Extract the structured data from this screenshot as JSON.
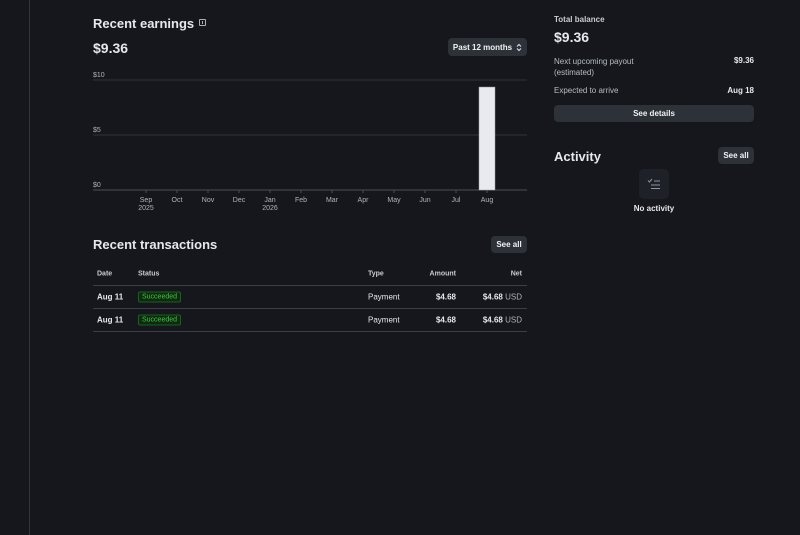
{
  "earnings": {
    "title": "Recent earnings",
    "total": "$9.36",
    "range_label": "Past 12 months"
  },
  "chart_data": {
    "type": "bar",
    "categories": [
      "Sep",
      "Oct",
      "Nov",
      "Dec",
      "Jan",
      "Feb",
      "Mar",
      "Apr",
      "May",
      "Jun",
      "Jul",
      "Aug"
    ],
    "category_sublabels": [
      "2025",
      "",
      "",
      "",
      "2026",
      "",
      "",
      "",
      "",
      "",
      "",
      ""
    ],
    "values": [
      0,
      0,
      0,
      0,
      0,
      0,
      0,
      0,
      0,
      0,
      0,
      9.36
    ],
    "yticks": [
      "$10",
      "$5",
      "$0"
    ],
    "ylim": [
      0,
      10
    ],
    "title": "",
    "xlabel": "",
    "ylabel": "",
    "grid": true,
    "bar_color": "#e8eaf0"
  },
  "transactions": {
    "title": "Recent transactions",
    "see_all_label": "See all",
    "columns": [
      "Date",
      "Status",
      "Type",
      "Amount",
      "Net"
    ],
    "rows": [
      {
        "date": "Aug 11",
        "status": "Succeeded",
        "type": "Payment",
        "amount": "$4.68",
        "net": "$4.68",
        "currency": "USD"
      },
      {
        "date": "Aug 11",
        "status": "Succeeded",
        "type": "Payment",
        "amount": "$4.68",
        "net": "$4.68",
        "currency": "USD"
      }
    ]
  },
  "balance": {
    "title": "Total balance",
    "amount": "$9.36",
    "payout_label": "Next upcoming payout (estimated)",
    "payout_value": "$9.36",
    "arrive_label": "Expected to arrive",
    "arrive_value": "Aug 18",
    "details_label": "See details"
  },
  "activity": {
    "title": "Activity",
    "see_all_label": "See all",
    "empty_label": "No activity",
    "empty_icon": "checklist-icon"
  },
  "colors": {
    "background": "#15171d",
    "success": "#45c646",
    "button": "#2d3138"
  }
}
